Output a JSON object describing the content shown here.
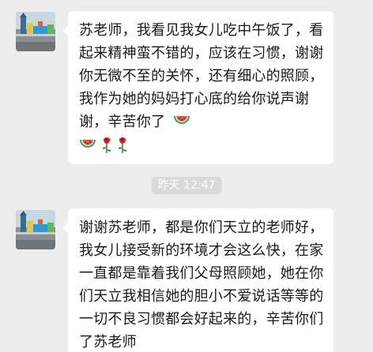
{
  "messages": [
    {
      "sender_avatar": "playground-photo-avatar",
      "text": "苏老师，我看见我女儿吃中午饭了，看起来精神蛮不错的，应该在习惯，谢谢你无微不至的关怀，还有细心的照顾，我作为她的妈妈打心底的给你说声谢谢，辛苦你了",
      "emojis": [
        "watermelon-emoji",
        "watermelon-emoji",
        "rose-emoji",
        "rose-emoji"
      ]
    },
    {
      "sender_avatar": "playground-photo-avatar",
      "text": "谢谢苏老师，都是你们天立的老师好，我女儿接受新的环境才会这么快，在家一直都是靠着我们父母照顾她，她在你们天立我相信她的胆小不爱说话等等的一切不良习惯都会好起来的，辛苦你们了苏老师"
    }
  ],
  "timestamp": "昨天 12:47",
  "colors": {
    "background": "#ededed",
    "bubble": "#ffffff",
    "text": "#1a1a1a",
    "timestamp_pill": "#dadada"
  }
}
